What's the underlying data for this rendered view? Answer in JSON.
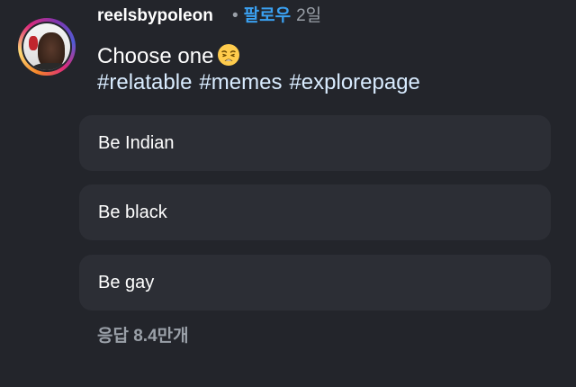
{
  "post": {
    "username": "reelsbypoleon",
    "separator": "•",
    "follow_label": "팔로우",
    "time_ago": "2일",
    "caption_text": "Choose one",
    "caption_emoji": "weary-face-emoji",
    "hashtags": [
      "#relatable",
      "#memes",
      "#explorepage"
    ]
  },
  "poll": {
    "options": [
      {
        "label": "Be Indian"
      },
      {
        "label": "Be black"
      },
      {
        "label": "Be gay"
      }
    ],
    "responses_label": "응답 8.4만개"
  },
  "colors": {
    "background": "#23252b",
    "option_background": "#2c2e35",
    "follow": "#3aa0f0",
    "hashtag": "#d9ecff",
    "muted": "#9aa0a8"
  }
}
